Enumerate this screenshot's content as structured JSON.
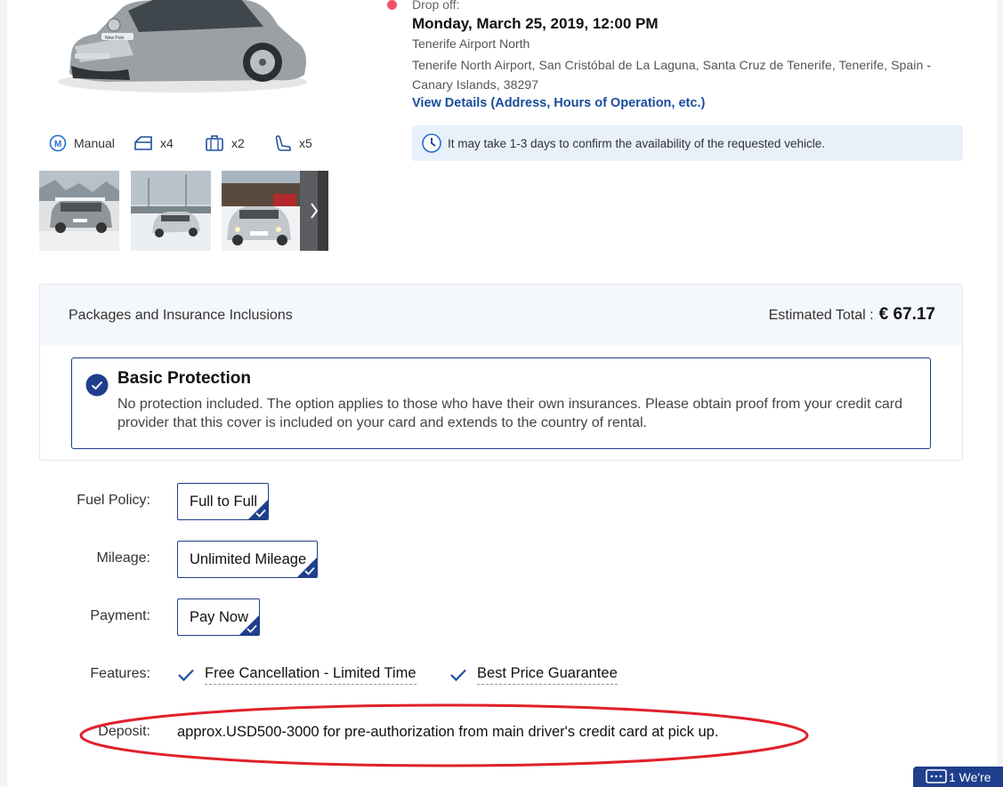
{
  "car": {
    "specs": [
      {
        "icon": "transmission-icon",
        "label": "Manual"
      },
      {
        "icon": "door-icon",
        "label": "x4"
      },
      {
        "icon": "luggage-icon",
        "label": "x2"
      },
      {
        "icon": "seat-icon",
        "label": "x5"
      }
    ],
    "badge_letter": "M"
  },
  "dropoff": {
    "label": "Drop off:",
    "date": "Monday, March 25, 2019, 12:00 PM",
    "location": "Tenerife Airport North",
    "address": "Tenerife North Airport, San Cristóbal de La Laguna, Santa Cruz de Tenerife, Tenerife, Spain - Canary Islands, 38297",
    "details_link": "View Details (Address, Hours of Operation, etc.)",
    "notice": "It may take 1-3 days to confirm the availability of the requested vehicle."
  },
  "packages": {
    "title": "Packages and Insurance Inclusions",
    "total_label": "Estimated Total :",
    "total_amount": "€ 67.17",
    "protection_title": "Basic Protection",
    "protection_desc": "No protection included. The option applies to those who have their own insurances. Please obtain proof from your credit card provider that this cover is included on your card and extends to the country of rental."
  },
  "options": {
    "fuel_label": "Fuel Policy:",
    "fuel_value": "Full to Full",
    "mileage_label": "Mileage:",
    "mileage_value": "Unlimited Mileage",
    "payment_label": "Payment:",
    "payment_value": "Pay Now",
    "features_label": "Features:",
    "features": [
      "Free Cancellation - Limited Time",
      "Best Price Guarantee"
    ],
    "deposit_label": "Deposit:",
    "deposit_value": "approx.USD500-3000 for pre-authorization from main driver's credit card at pick up."
  },
  "chat": {
    "label": "1 We're"
  },
  "colors": {
    "accent": "#1f3f8c",
    "link": "#1a4d9c",
    "highlight": "#e0202a",
    "dot": "#f05365"
  }
}
